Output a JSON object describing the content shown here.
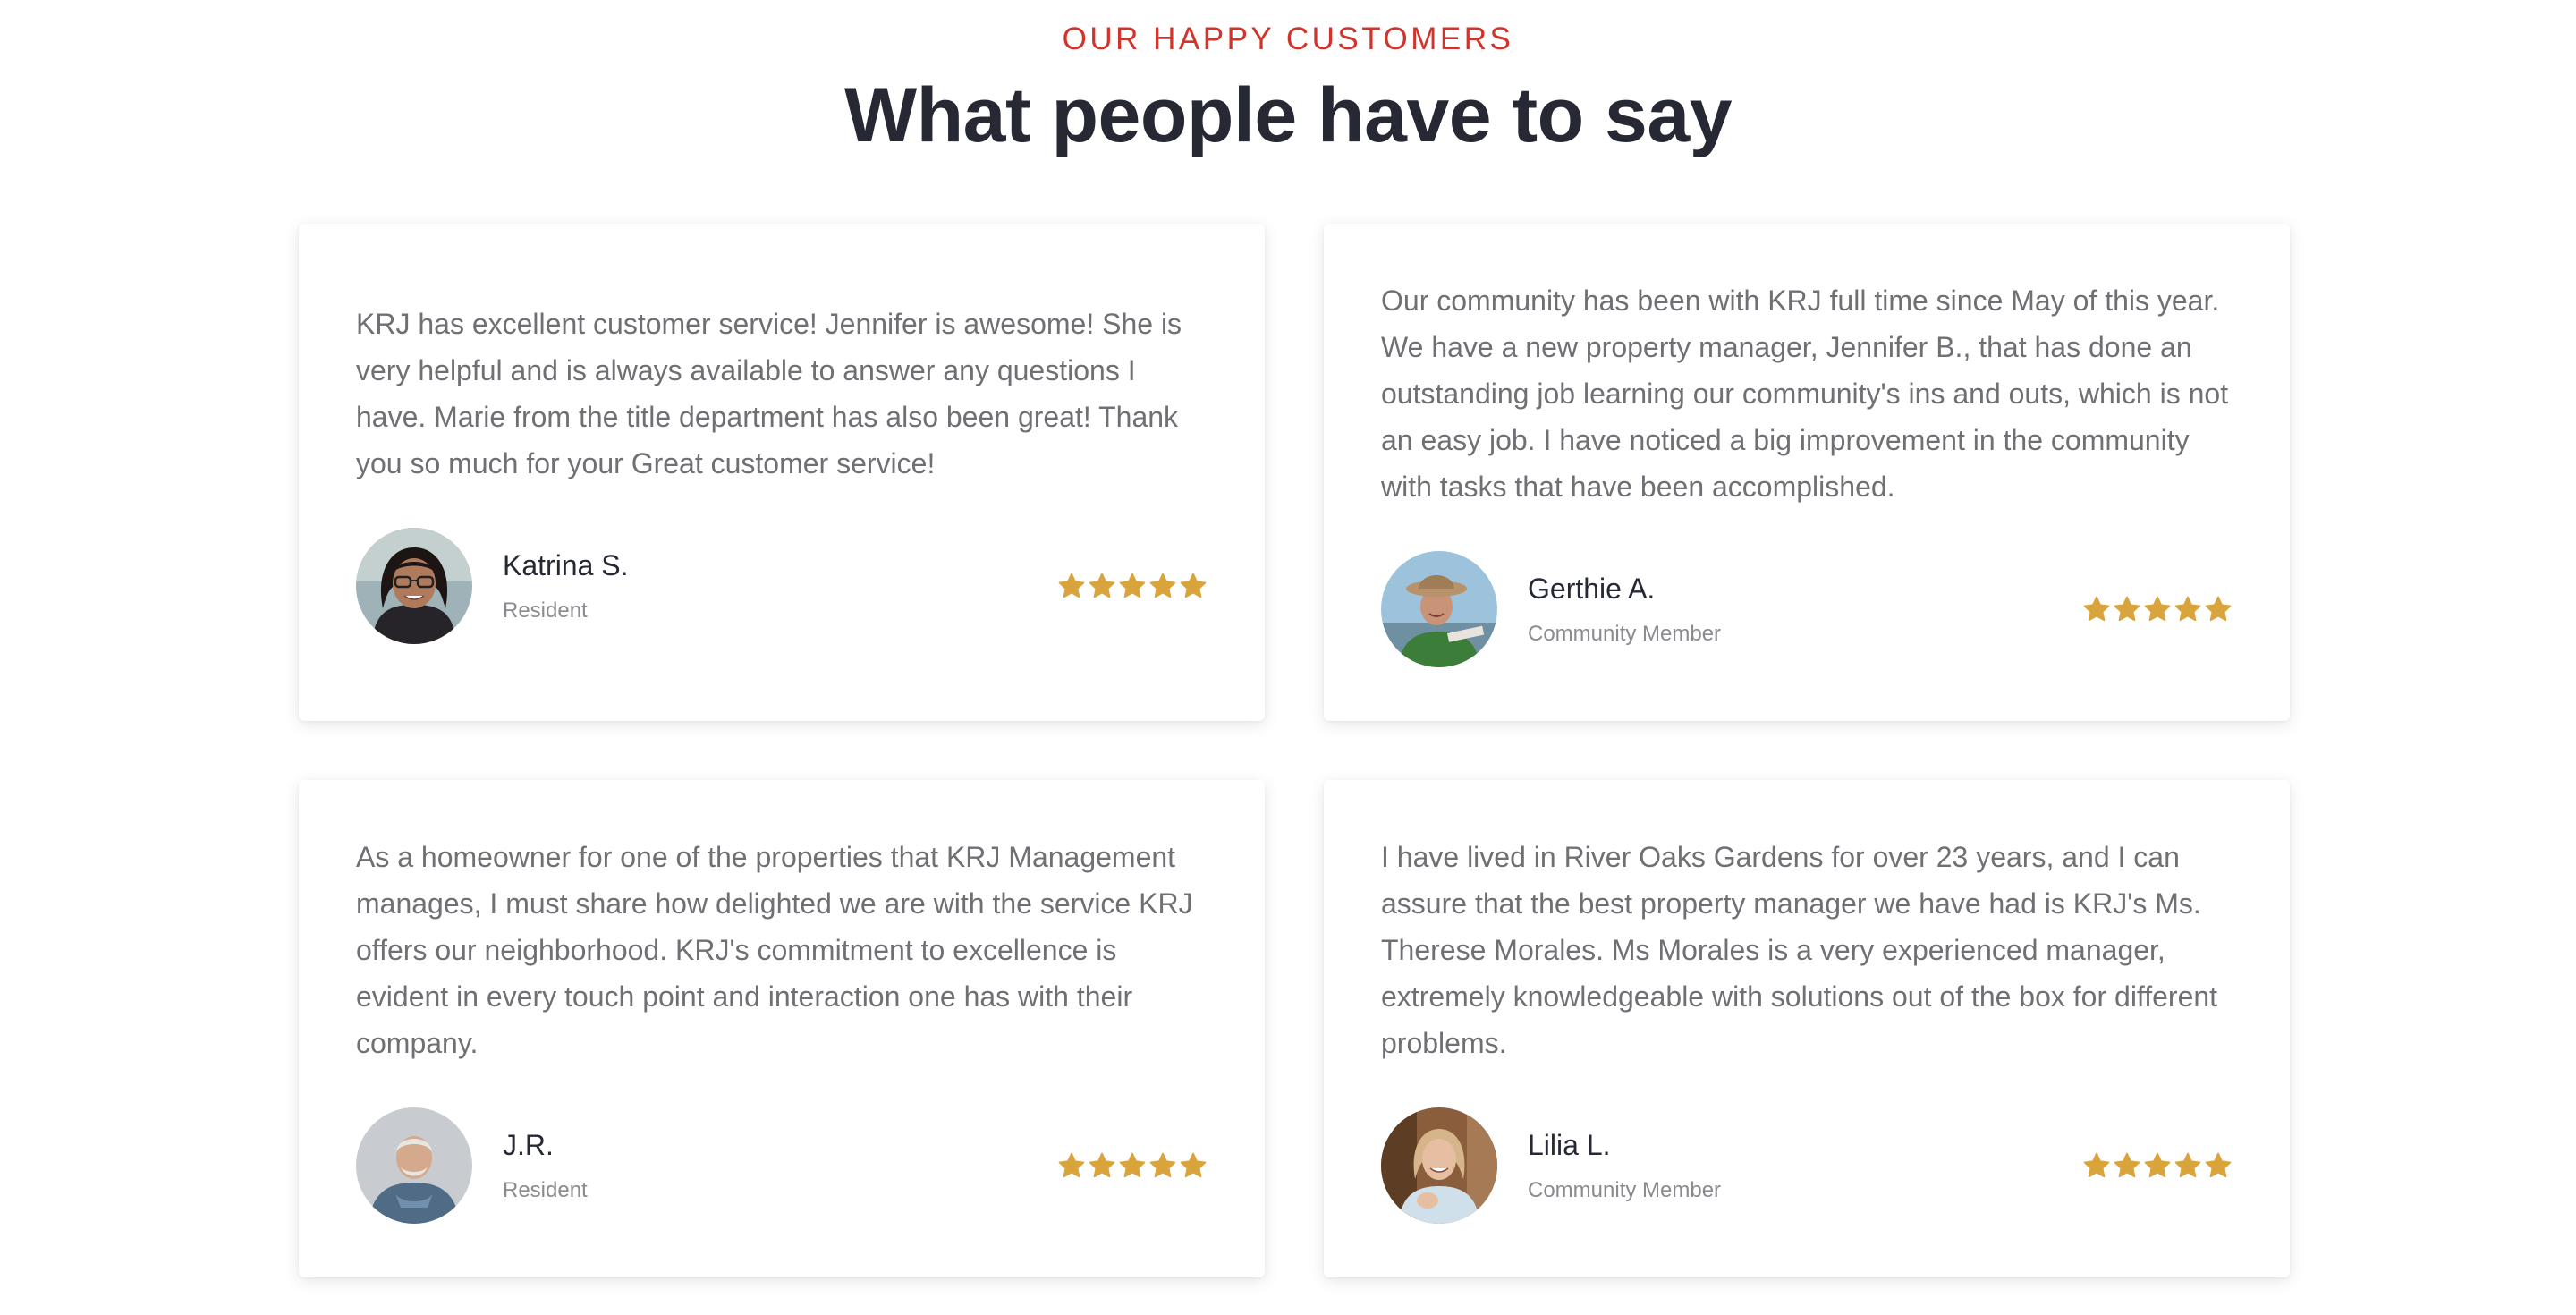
{
  "header": {
    "eyebrow": "OUR HAPPY CUSTOMERS",
    "title": "What people have to say"
  },
  "colors": {
    "accent": "#d0342c",
    "star": "#d9a43b",
    "heading": "#262833",
    "body_text": "#6f6f74"
  },
  "testimonials": [
    {
      "quote": "KRJ has excellent customer service! Jennifer is awesome! She is very helpful and is always available to answer any questions I have. Marie from the title department has also been great! Thank you so much for your Great customer service!",
      "name": "Katrina S.",
      "role": "Resident",
      "rating": 5
    },
    {
      "quote": "Our community has been with KRJ full time since May of this year. We have a new property manager, Jennifer B., that has done an outstanding job learning our community's ins and outs, which is not an easy job. I have noticed a big improvement in the community with tasks that have been accomplished.",
      "name": "Gerthie A.",
      "role": "Community Member",
      "rating": 5
    },
    {
      "quote": "As a homeowner for one of the properties that KRJ Management manages, I must share how delighted we are with the service KRJ offers our neighborhood. KRJ's commitment to excellence is evident in every touch point and interaction one has with their company.",
      "name": "J.R.",
      "role": "Resident",
      "rating": 5
    },
    {
      "quote": "I have lived in River Oaks Gardens for over 23 years, and I can assure that the best property manager we have had is KRJ's Ms. Therese Morales. Ms Morales is a very experienced manager, extremely knowledgeable with solutions out of the box for different problems.",
      "name": "Lilia L.",
      "role": "Community Member",
      "rating": 5
    }
  ]
}
